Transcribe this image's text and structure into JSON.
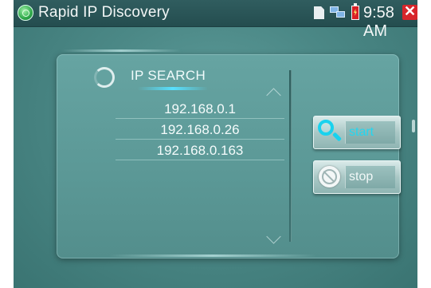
{
  "status_bar": {
    "app_title": "Rapid IP Discovery",
    "time": "9:58 AM",
    "icons": [
      "app-logo-icon",
      "sd-card-icon",
      "network-icon",
      "battery-charging-icon"
    ],
    "close_glyph": "✕",
    "close_color": "#d7262b"
  },
  "panel": {
    "heading": "IP  SEARCH",
    "results": [
      "192.168.0.1",
      "192.168.0.26",
      "192.168.0.163"
    ]
  },
  "buttons": {
    "start_label": "start",
    "stop_label": "stop",
    "start_icon": "search-icon",
    "stop_icon": "stop-icon",
    "accent_color": "#23d6f0"
  }
}
